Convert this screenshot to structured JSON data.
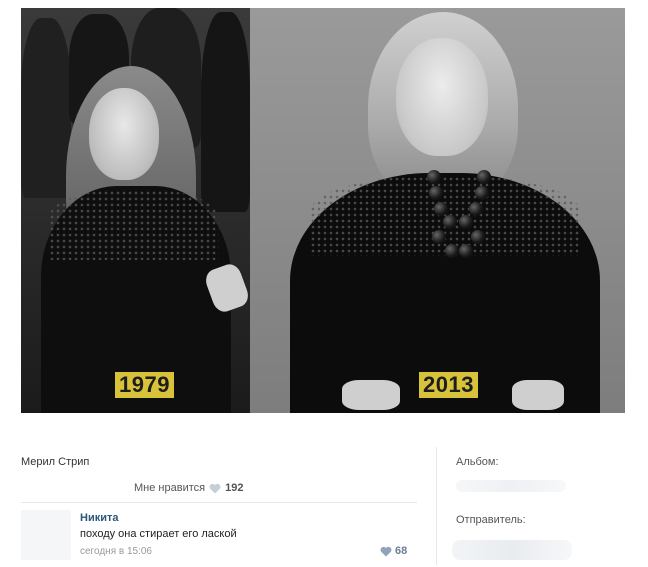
{
  "photo": {
    "left_year": "1979",
    "right_year": "2013"
  },
  "post": {
    "caption": "Мерил Стрип",
    "likes_label": "Мне нравится",
    "likes_count": "192"
  },
  "comment": {
    "author": "Никита",
    "text": "походу она стирает его лаской",
    "timestamp": "сегодня в 15:06",
    "likes_count": "68"
  },
  "sidebar": {
    "album_label": "Альбом:",
    "sender_label": "Отправитель:"
  },
  "colors": {
    "year_badge": "#d8c23a",
    "link": "#2b587a",
    "heart": "#b6c3d2"
  },
  "icons": {
    "likes": "heart-icon",
    "comment_likes": "heart-icon"
  }
}
